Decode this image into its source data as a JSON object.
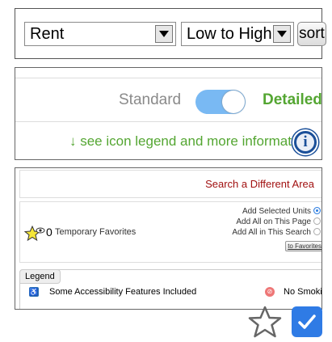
{
  "sort": {
    "field": "Rent",
    "order": "Low to High",
    "button_label": "sort"
  },
  "view_toggle": {
    "left_label": "Standard",
    "right_label": "Detailed",
    "selected": "Detailed"
  },
  "legend_link": "↓ see icon legend and more information",
  "search": {
    "link_text": "Search a Different Area"
  },
  "favorites": {
    "count": "0",
    "label": "Temporary Favorites",
    "actions": [
      {
        "label": "Add Selected Units",
        "selected": true
      },
      {
        "label": "Add All on This Page",
        "selected": false
      },
      {
        "label": "Add All in This Search",
        "selected": false
      }
    ],
    "button_label": "to Favorites"
  },
  "legend": {
    "title": "Legend",
    "items": [
      {
        "icon": "accessibility-icon",
        "label": "Some Accessibility Features Included"
      },
      {
        "icon": "no-smoking-icon",
        "label": "No Smoking"
      }
    ]
  },
  "colors": {
    "accent_green": "#54a632",
    "toggle_blue": "#79b9f3",
    "link_red": "#a11010",
    "info_blue": "#1a4f99",
    "checkbox_blue": "#2f7be5"
  }
}
